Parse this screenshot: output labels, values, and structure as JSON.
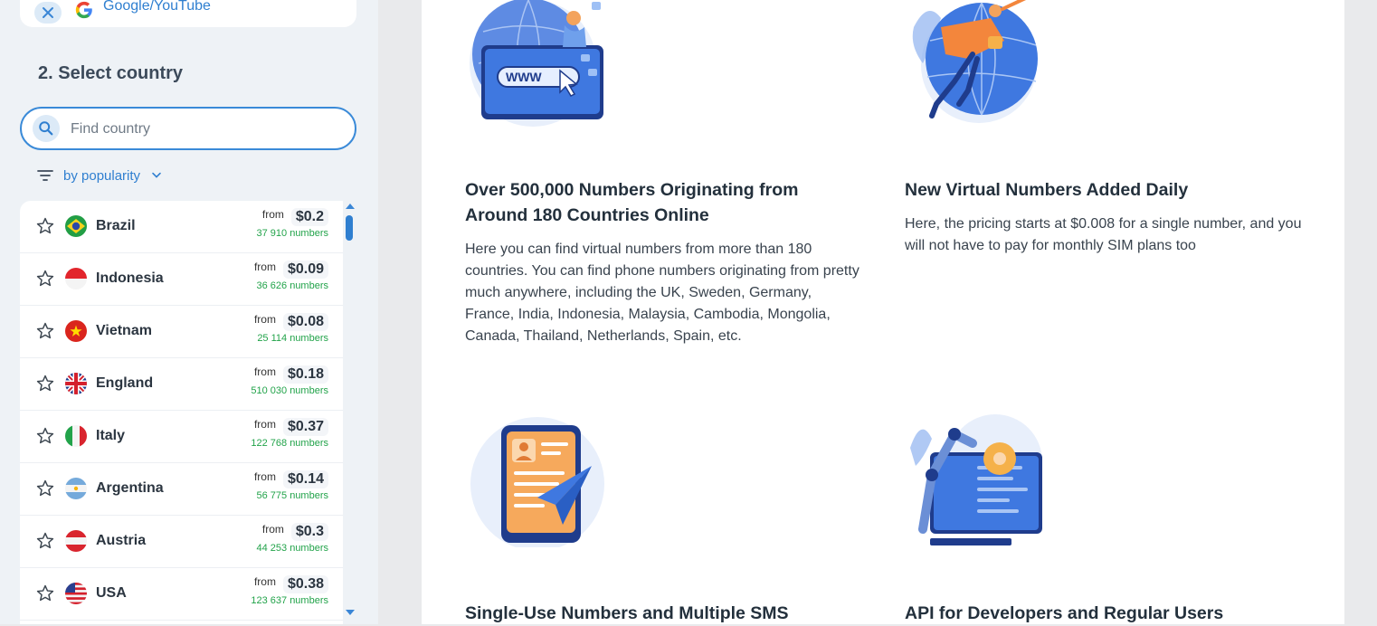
{
  "service": {
    "name": "Google/YouTube"
  },
  "step": {
    "title": "2. Select country"
  },
  "search": {
    "placeholder": "Find country"
  },
  "sort": {
    "label": "by popularity"
  },
  "countries": [
    {
      "name": "Brazil",
      "from": "from",
      "price": "$0.2",
      "count": "37 910 numbers"
    },
    {
      "name": "Indonesia",
      "from": "from",
      "price": "$0.09",
      "count": "36 626 numbers"
    },
    {
      "name": "Vietnam",
      "from": "from",
      "price": "$0.08",
      "count": "25 114 numbers"
    },
    {
      "name": "England",
      "from": "from",
      "price": "$0.18",
      "count": "510 030 numbers"
    },
    {
      "name": "Italy",
      "from": "from",
      "price": "$0.37",
      "count": "122 768 numbers"
    },
    {
      "name": "Argentina",
      "from": "from",
      "price": "$0.14",
      "count": "56 775 numbers"
    },
    {
      "name": "Austria",
      "from": "from",
      "price": "$0.3",
      "count": "44 253 numbers"
    },
    {
      "name": "USA",
      "from": "from",
      "price": "$0.38",
      "count": "123 637 numbers"
    }
  ],
  "features": [
    {
      "title": "Over 500,000 Numbers Originating from Around 180 Countries Online",
      "text": "Here you can find virtual numbers from more than 180 countries. You can find phone numbers originating from pretty much anywhere, including the UK, Sweden, Germany, France, India, Indonesia, Malaysia, Cambodia, Mongolia, Canada, Thailand, Netherlands, Spain, etc."
    },
    {
      "title": "New Virtual Numbers Added Daily",
      "text": "Here, the pricing starts at $0.008 for a single number, and you will not have to pay for monthly SIM plans too"
    },
    {
      "title": "Single-Use Numbers and Multiple SMS"
    },
    {
      "title": "API for Developers and Regular Users"
    }
  ],
  "illustrations": {
    "www_label": "WWW"
  },
  "colors": {
    "accent": "#2f7fd0",
    "count_green": "#22a34a",
    "sidebar_bg": "#eef2f6"
  },
  "icons": {
    "close": "close-icon",
    "search": "search-icon",
    "sort": "sort-icon",
    "chevron": "chevron-down-icon",
    "star": "star-outline-icon"
  }
}
